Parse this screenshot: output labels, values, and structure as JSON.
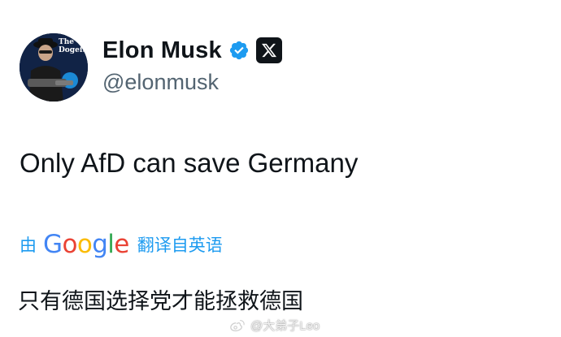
{
  "profile": {
    "display_name": "Elon Musk",
    "handle": "@elonmusk",
    "avatar_text": "The Dogefather",
    "verified_color": "#1d9bf0"
  },
  "tweet": {
    "text": "Only AfD can save Germany"
  },
  "translation": {
    "by": "由",
    "google": "Google",
    "google_letters": [
      "G",
      "o",
      "o",
      "g",
      "l",
      "e"
    ],
    "action": "翻译自英语",
    "translated_text": "只有德国选择党才能拯救德国",
    "link_color": "#1d9bf0"
  },
  "watermark": {
    "text": "@大弟子Leo"
  }
}
